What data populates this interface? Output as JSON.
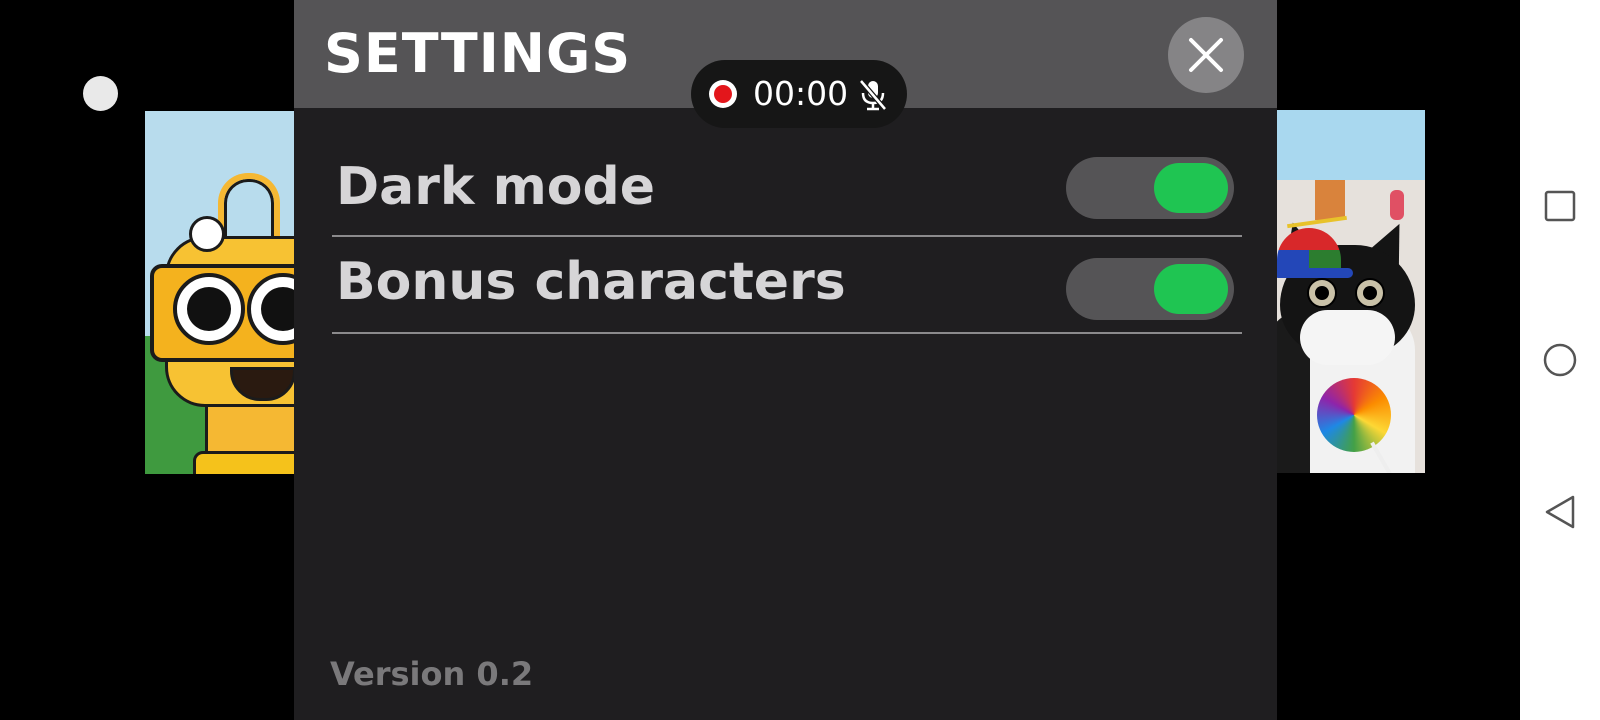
{
  "settings": {
    "title": "SETTINGS",
    "close_icon": "close-icon",
    "options": [
      {
        "label": "Dark mode",
        "enabled": true
      },
      {
        "label": "Bonus characters",
        "enabled": true
      }
    ],
    "version": "Version 0.2"
  },
  "recording": {
    "time": "00:00",
    "mic_icon": "mic-muted-icon"
  },
  "nav": {
    "recents_icon": "square-icon",
    "home_icon": "circle-icon",
    "back_icon": "triangle-back-icon"
  },
  "colors": {
    "toggle_on": "#1fc552",
    "panel_bg": "#1f1e20",
    "header_bg": "#555456",
    "record_red": "#e3161b"
  }
}
